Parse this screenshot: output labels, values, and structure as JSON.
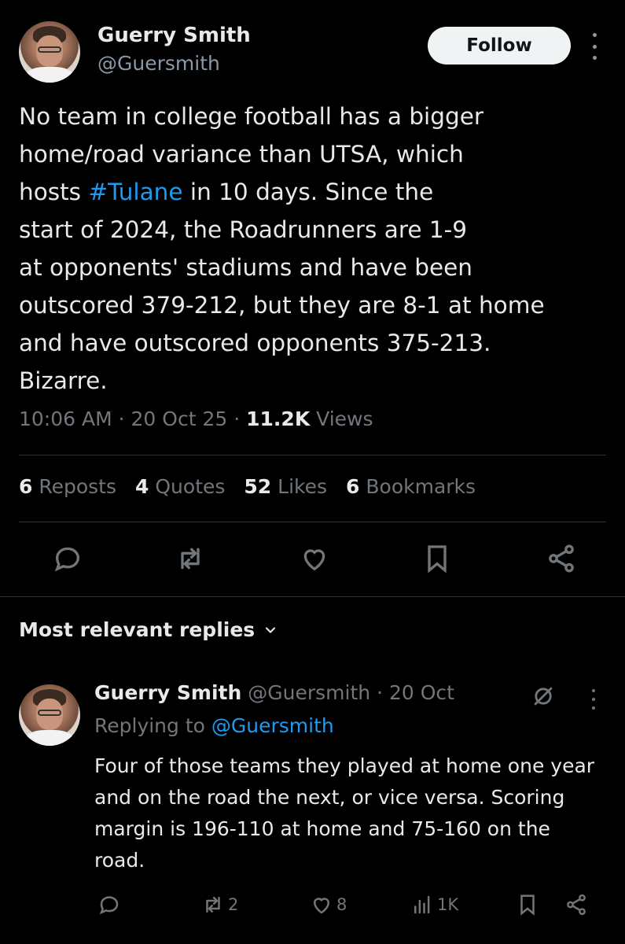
{
  "post": {
    "author_name": "Guerry Smith",
    "author_handle": "@Guersmith",
    "follow_label": "Follow",
    "text_before_tag": "No team in college football has a bigger\nhome/road variance than UTSA, which\nhosts ",
    "hashtag": "#Tulane",
    "text_after_tag": " in 10 days. Since the\nstart of 2024, the Roadrunners are 1-9\nat opponents' stadiums and have been\noutscored 379-212, but they are 8-1 at home\nand have outscored opponents 375-213.\nBizarre.",
    "time": "10:06 AM",
    "date": "20 Oct 25",
    "sep": "·",
    "views_count": "11.2K",
    "views_label": "Views"
  },
  "stats": {
    "reposts_count": "6",
    "reposts_label": "Reposts",
    "quotes_count": "4",
    "quotes_label": "Quotes",
    "likes_count": "52",
    "likes_label": "Likes",
    "bookmarks_count": "6",
    "bookmarks_label": "Bookmarks"
  },
  "replies_heading": "Most relevant replies",
  "reply": {
    "author_name": "Guerry Smith",
    "author_handle": "@Guersmith",
    "sep": "·",
    "date": "20 Oct",
    "replying_prefix": "Replying to ",
    "replying_mention": "@Guersmith",
    "text": "Four of those teams they played at home one year and on the road the next, or vice versa. Scoring margin is 196-110 at home and 75-160 on the road.",
    "reposts": "2",
    "likes": "8",
    "views": "1K"
  },
  "colors": {
    "background": "#000000",
    "text": "#e7e9ea",
    "muted": "#71767b",
    "link": "#1d9bf0",
    "follow_button_bg": "#eff3f4"
  },
  "icons": [
    "reply-icon",
    "repost-icon",
    "like-icon",
    "bookmark-icon",
    "share-icon",
    "chevron-down-icon",
    "grok-icon",
    "views-icon",
    "more-icon"
  ]
}
